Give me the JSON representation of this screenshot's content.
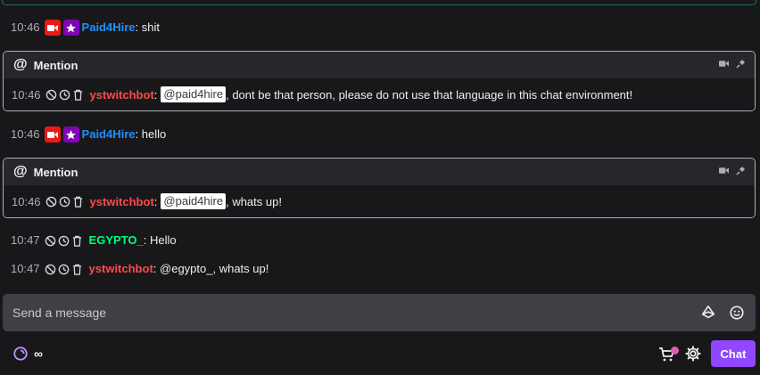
{
  "chat": [
    {
      "kind": "line",
      "time": "10:46",
      "badges": [
        "broadcaster",
        "vip"
      ],
      "user": "Paid4Hire",
      "user_color": "#1e90ff",
      "colon": ":",
      "text": " shit"
    },
    {
      "kind": "mention",
      "title": "Mention",
      "time": "10:46",
      "user": "ystwitchbot",
      "user_color": "#ff4a4a",
      "colon": ":",
      "tag": "@paid4hire",
      "text": ", dont be that person, please do not use that language in this chat environment!"
    },
    {
      "kind": "line",
      "time": "10:46",
      "badges": [
        "broadcaster",
        "vip"
      ],
      "user": "Paid4Hire",
      "user_color": "#1e90ff",
      "colon": ":",
      "text": " hello"
    },
    {
      "kind": "mention",
      "title": "Mention",
      "time": "10:46",
      "user": "ystwitchbot",
      "user_color": "#ff4a4a",
      "colon": ":",
      "tag": "@paid4hire",
      "text": ", whats up!"
    },
    {
      "kind": "line",
      "time": "10:47",
      "user": "EGYPTO_",
      "user_color": "#00ff7f",
      "colon": ":",
      "text": " Hello"
    },
    {
      "kind": "line",
      "time": "10:47",
      "user": "ystwitchbot",
      "user_color": "#ff4a4a",
      "colon": ":",
      "text": " @egypto_, whats up!"
    }
  ],
  "input": {
    "placeholder": "Send a message"
  },
  "footer": {
    "points": "∞",
    "chat_button": "Chat"
  },
  "colors": {
    "accent": "#9147ff",
    "background": "#18181b",
    "input": "#3f3f46"
  }
}
